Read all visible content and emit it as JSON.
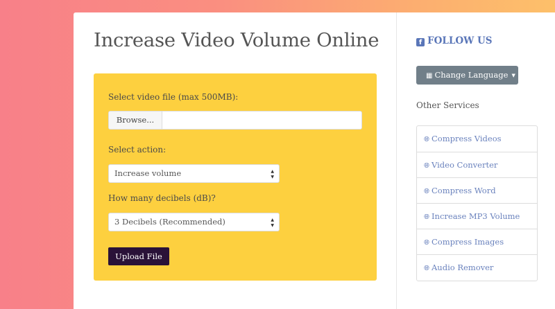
{
  "page": {
    "title": "Increase Video Volume Online"
  },
  "form": {
    "file_label": "Select video file (max 500MB):",
    "browse_label": "Browse...",
    "file_value": "",
    "action_label": "Select action:",
    "action_value": "Increase volume",
    "decibels_label": "How many decibels (dB)?",
    "decibels_value": "3 Decibels (Recommended)",
    "upload_label": "Upload File"
  },
  "sidebar": {
    "follow_label": "FOLLOW US",
    "follow_icon": "facebook-icon",
    "language_button": "Change Language",
    "language_icon": "language-icon",
    "other_services_label": "Other Services",
    "services": [
      {
        "label": "Compress Videos",
        "icon": "globe-icon"
      },
      {
        "label": "Video Converter",
        "icon": "globe-icon"
      },
      {
        "label": "Compress Word",
        "icon": "globe-icon"
      },
      {
        "label": "Increase MP3 Volume",
        "icon": "globe-icon"
      },
      {
        "label": "Compress Images",
        "icon": "globe-icon"
      },
      {
        "label": "Audio Remover",
        "icon": "globe-icon"
      }
    ]
  },
  "colors": {
    "panel": "#fdd03f",
    "upload_button": "#2a1238",
    "link": "#6a82bd",
    "language_button": "#717f89"
  }
}
